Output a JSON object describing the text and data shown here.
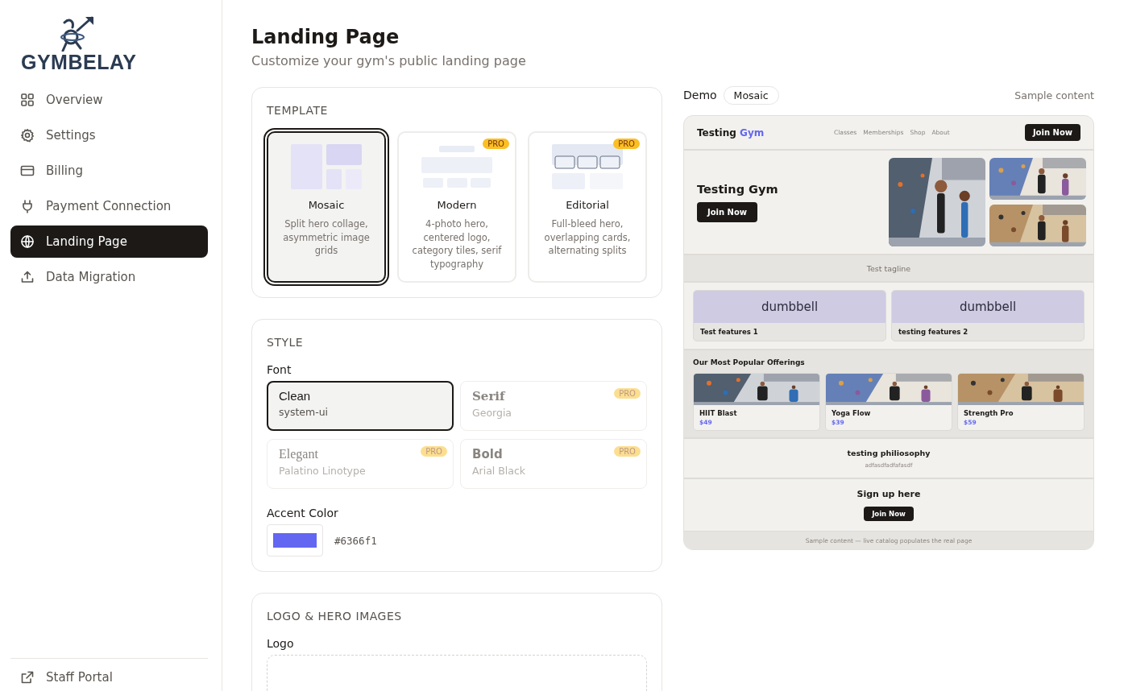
{
  "brand": {
    "name": "GYMBELAY"
  },
  "sidebar": {
    "items": [
      {
        "label": "Overview",
        "selected": false
      },
      {
        "label": "Settings",
        "selected": false
      },
      {
        "label": "Billing",
        "selected": false
      },
      {
        "label": "Payment Connection",
        "selected": false
      },
      {
        "label": "Landing Page",
        "selected": true
      },
      {
        "label": "Data Migration",
        "selected": false
      }
    ],
    "footer_items": [
      {
        "label": "Staff Portal"
      }
    ]
  },
  "header": {
    "title": "Landing Page",
    "subtitle": "Customize your gym's public landing page"
  },
  "template_section": {
    "title": "TEMPLATE",
    "templates": [
      {
        "kind": "mosaic",
        "name": "Mosaic",
        "description": "Split hero collage, asymmetric image grids",
        "selected": true
      },
      {
        "kind": "modern",
        "name": "Modern",
        "description": "4-photo hero, centered logo, category tiles, serif typography",
        "badge": "PRO",
        "selected": false
      },
      {
        "kind": "editorial",
        "name": "Editorial",
        "description": "Full-bleed hero, overlapping cards, alternating splits",
        "badge": "PRO",
        "selected": false
      }
    ]
  },
  "style_section": {
    "title": "STYLE",
    "font_label": "Font",
    "fonts": [
      {
        "kind": "sans",
        "name": "Clean",
        "family": "system-ui",
        "selected": true,
        "disabled": false
      },
      {
        "kind": "serif",
        "name": "Serif",
        "family": "Georgia",
        "badge": "PRO",
        "selected": false,
        "disabled": true
      },
      {
        "kind": "elegant",
        "name": "Elegant",
        "family": "Palatino Linotype",
        "badge": "PRO",
        "selected": false,
        "disabled": true
      },
      {
        "kind": "bold",
        "name": "Bold",
        "family": "Arial Black",
        "badge": "PRO",
        "selected": false,
        "disabled": true
      }
    ],
    "accent_label": "Accent Color",
    "accent_value": "#6366f1"
  },
  "logo_section": {
    "title": "LOGO & HERO IMAGES",
    "logo_label": "Logo"
  },
  "demo": {
    "label": "Demo",
    "template_chip": "Mosaic",
    "note": "Sample content",
    "site": {
      "brand": "Testing",
      "brand_accent": "Gym",
      "nav": [
        "Classes",
        "Memberships",
        "Shop",
        "About"
      ],
      "nav_button": "Join Now",
      "hero_title": "Testing Gym",
      "hero_button": "Join Now",
      "tagline": "Test tagline",
      "features": [
        {
          "icon_text": "dumbbell",
          "title": "Test features 1"
        },
        {
          "icon_text": "dumbbell",
          "title": "testing features 2"
        }
      ],
      "offerings_title": "Our Most Popular Offerings",
      "offerings": [
        {
          "name": "HIIT Blast",
          "price": "$49"
        },
        {
          "name": "Yoga Flow",
          "price": "$39"
        },
        {
          "name": "Strength Pro",
          "price": "$59"
        }
      ],
      "philosophy_title": "testing philiosophy",
      "philosophy_text": "adfasdfadfafasdf",
      "signup_title": "Sign up here",
      "signup_button": "Join Now",
      "footer": "Sample content — live catalog populates the real page"
    }
  }
}
